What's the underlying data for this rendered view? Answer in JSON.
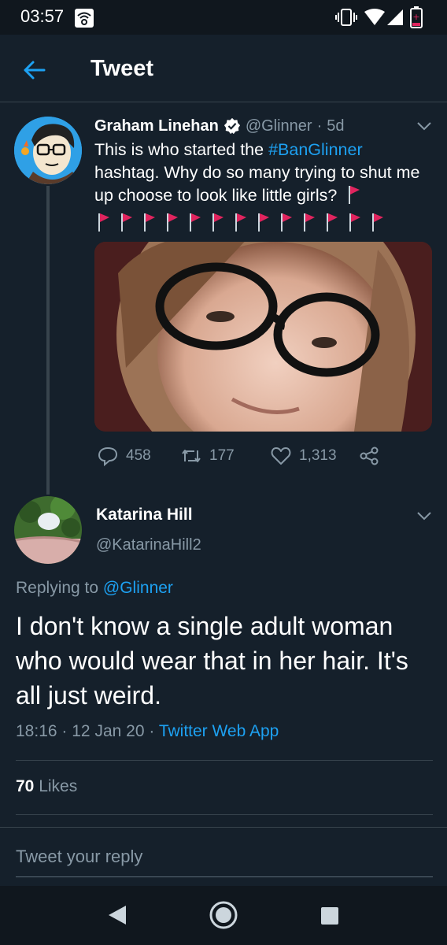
{
  "status_bar": {
    "time": "03:57"
  },
  "header": {
    "title": "Tweet"
  },
  "tweet": {
    "author_name": "Graham Linehan",
    "handle": "@Glinner",
    "separator": "·",
    "age": "5d",
    "text_before": "This is who started the ",
    "hashtag": "#BanGlinner",
    "text_after": " hashtag. Why do so many trying to shut me up choose to look like little girls?",
    "flag_count": 13,
    "replies": "458",
    "retweets": "177",
    "likes": "1,313"
  },
  "reply": {
    "author_name": "Katarina Hill",
    "handle": "@KatarinaHill2",
    "replying_prefix": "Replying to",
    "replying_to": "@Glinner",
    "text": "I don't know a single adult woman who would wear that in her hair. It's all just weird.",
    "time": "18:16",
    "date": "12 Jan 20",
    "separator": "·",
    "source": "Twitter Web App",
    "likes_count": "70",
    "likes_label": "Likes"
  },
  "compose": {
    "placeholder": "Tweet your reply"
  },
  "colors": {
    "background": "#15202b",
    "accent": "#1da1f2",
    "muted": "#8899a6",
    "border": "#38444d",
    "flag": "#e0245e"
  }
}
